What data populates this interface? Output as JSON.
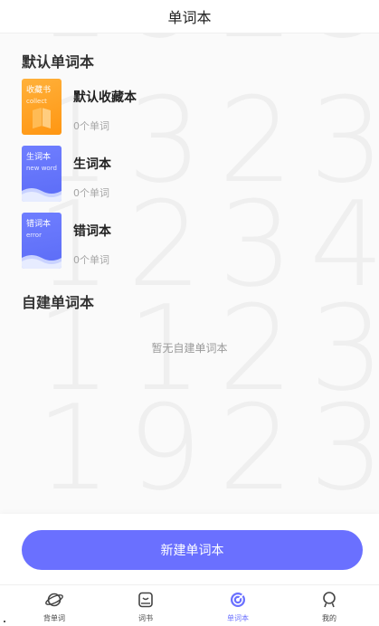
{
  "header": {
    "title": "单词本"
  },
  "sections": {
    "default_title": "默认单词本",
    "custom_title": "自建单词本",
    "custom_empty_text": "暂无自建单词本"
  },
  "books": [
    {
      "name": "默认收藏本",
      "count": "0个单词",
      "cover_title": "收藏书",
      "cover_sub": "collect",
      "cover_color": "#ff9f1a"
    },
    {
      "name": "生词本",
      "count": "0个单词",
      "cover_title": "生词本",
      "cover_sub": "new word",
      "cover_color": "#6675ff"
    },
    {
      "name": "错词本",
      "count": "0个单词",
      "cover_title": "错词本",
      "cover_sub": "error",
      "cover_color": "#6675ff"
    }
  ],
  "actions": {
    "new_book_label": "新建单词本"
  },
  "tabbar": {
    "items": [
      {
        "label": "背单词",
        "icon": "planet-icon",
        "active": false
      },
      {
        "label": "词书",
        "icon": "book-icon",
        "active": false
      },
      {
        "label": "单词本",
        "icon": "target-icon",
        "active": true
      },
      {
        "label": "我的",
        "icon": "user-icon",
        "active": false
      }
    ]
  },
  "colors": {
    "accent": "#6a70ff",
    "orange": "#ff9f1a",
    "background": "#fafafa"
  }
}
